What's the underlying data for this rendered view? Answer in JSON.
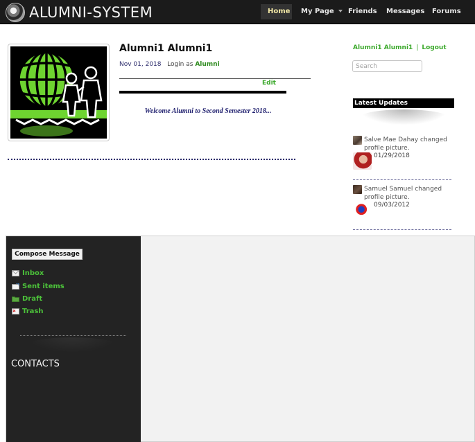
{
  "brand": {
    "name": "ALUMNI-SYSTEM"
  },
  "nav": {
    "home": "Home",
    "my_page": "My Page",
    "friends": "Friends",
    "messages": "Messages",
    "forums": "Forums"
  },
  "profile": {
    "name": "Alumni1 Alumni1",
    "date": "Nov 01, 2018",
    "login_prefix": "Login as",
    "role": "Alumni",
    "edit_label": "Edit",
    "welcome": "Welcome Alumni to Second Semester 2018..."
  },
  "user_links": {
    "username": "Alumni1 Alumni1",
    "separator": "|",
    "logout": "Logout"
  },
  "search": {
    "placeholder": "Search"
  },
  "updates": {
    "title": "Latest Updates",
    "items": [
      {
        "text": "Salve Mae Dahay changed profile picture.",
        "date": "01/29/2018"
      },
      {
        "text": "Samuel Samuel changed profile picture.",
        "date": "09/03/2012"
      }
    ]
  },
  "messages_panel": {
    "compose_label": "Compose Message",
    "folders": [
      "Inbox",
      "Sent items",
      "Draft",
      "Trash"
    ],
    "contacts_title": "CONTACTS"
  },
  "colors": {
    "nav_bg": "#1b1b1b",
    "accent_green": "#3aa82a",
    "folder_green": "#4cc23a",
    "welcome_navy": "#1f1f6e",
    "sidebar_bg": "#232323"
  }
}
